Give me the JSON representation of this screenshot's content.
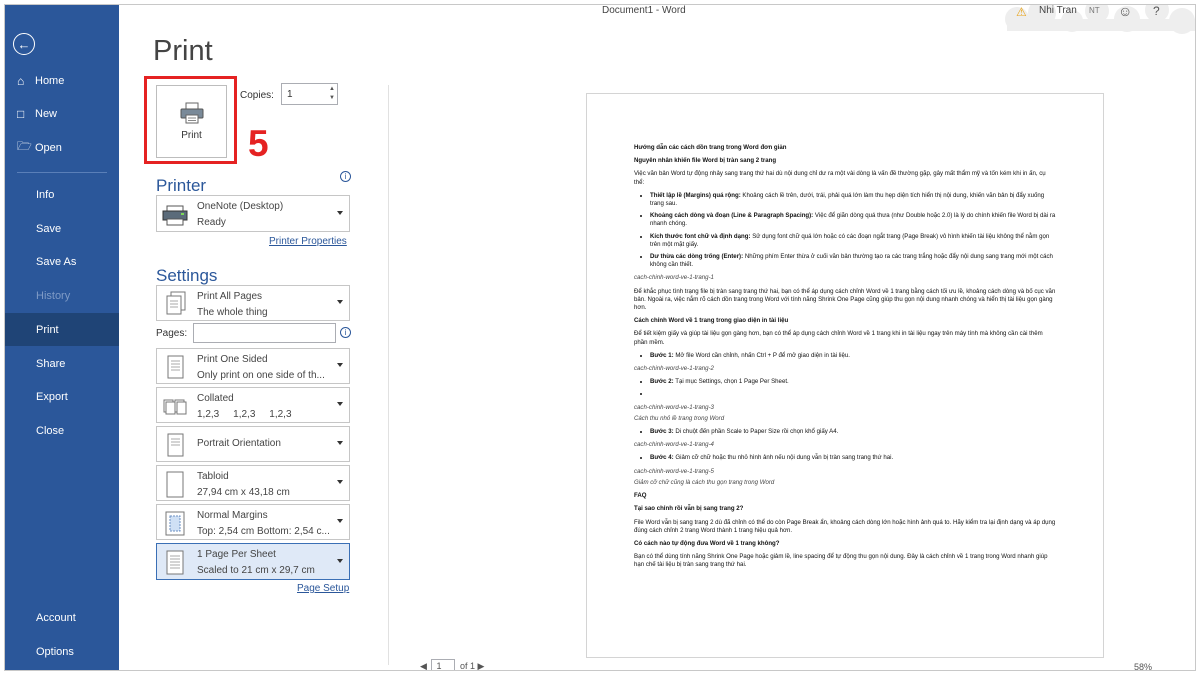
{
  "window": {
    "title": "Document1  -  Word",
    "user_name": "Nhi Tran",
    "user_initials": "NT"
  },
  "sidebar": {
    "items": [
      {
        "label": "Home",
        "icon": "home-icon"
      },
      {
        "label": "New",
        "icon": "new-document-icon"
      },
      {
        "label": "Open",
        "icon": "folder-icon"
      },
      {
        "label": "Info"
      },
      {
        "label": "Save"
      },
      {
        "label": "Save As"
      },
      {
        "label": "History"
      },
      {
        "label": "Print"
      },
      {
        "label": "Share"
      },
      {
        "label": "Export"
      },
      {
        "label": "Close"
      },
      {
        "label": "Account"
      },
      {
        "label": "Options"
      }
    ],
    "active": "Print",
    "disabled": "History"
  },
  "print_panel": {
    "title": "Print",
    "print_button_label": "Print",
    "step_number": "5",
    "copies_label": "Copies:",
    "copies_value": "1",
    "printer_heading": "Printer",
    "printer": {
      "name": "OneNote (Desktop)",
      "status": "Ready"
    },
    "printer_properties_link": "Printer Properties",
    "settings_heading": "Settings",
    "settings": [
      {
        "l1": "Print All Pages",
        "l2": "The whole thing",
        "icon": "pages-icon"
      },
      {
        "l1": "Print One Sided",
        "l2": "Only print on one side of th...",
        "icon": "one-sided-icon"
      },
      {
        "l1": "Collated",
        "l2": "1,2,3     1,2,3     1,2,3",
        "icon": "collated-icon"
      },
      {
        "l1": "Portrait Orientation",
        "l2": "",
        "icon": "portrait-icon"
      },
      {
        "l1": "Tabloid",
        "l2": "27,94 cm x 43,18 cm",
        "icon": "paper-size-icon"
      },
      {
        "l1": "Normal Margins",
        "l2": "Top: 2,54 cm Bottom: 2,54 c...",
        "icon": "margins-icon"
      },
      {
        "l1": "1 Page Per Sheet",
        "l2": "Scaled to 21 cm x 29,7 cm",
        "icon": "pages-per-sheet-icon"
      }
    ],
    "pages_label": "Pages:",
    "pages_value": "",
    "page_setup_link": "Page Setup"
  },
  "preview": {
    "current_page": "1",
    "of_pages": "of 1",
    "zoom": "58%",
    "content": {
      "title": "Hướng dẫn các cách dồn trang trong Word đơn giản",
      "h1": "Nguyên nhân khiến file Word bị tràn sang 2 trang",
      "p1": "Việc văn bản Word tự động nhảy sang trang thứ hai dù nội dung chỉ dư ra một vài dòng là vấn đề thường gặp, gây mất thẩm mỹ và tốn kém khi in ấn, cụ thể:",
      "bullets1": [
        {
          "b": "Thiết lập lề (Margins) quá rộng:",
          "t": " Khoảng cách lề trên, dưới, trái, phải quá lớn làm thu hẹp diện tích hiển thị nội dung, khiến văn bản bị đẩy xuống trang sau."
        },
        {
          "b": "Khoảng cách dòng và đoạn (Line & Paragraph Spacing):",
          "t": " Việc để giãn dòng quá thưa (như Double hoặc 2.0) là lý do chính khiến file Word bị dài ra nhanh chóng."
        },
        {
          "b": "Kích thước font chữ và định dạng:",
          "t": " Sử dụng font chữ quá lớn hoặc có các đoạn ngắt trang (Page Break) vô hình khiến tài liệu không thể nằm gọn trên một mặt giấy."
        },
        {
          "b": "Dư thừa các dòng trống (Enter):",
          "t": " Những phím Enter thừa ở cuối văn bản thường tạo ra các trang trắng hoặc đẩy nội dung sang trang mới một cách không cần thiết."
        }
      ],
      "cap1": "cach-chinh-word-ve-1-trang-1",
      "p2": "Để khắc phục tình trạng file bị tràn sang trang thứ hai, bạn có thể áp dụng cách chỉnh Word về 1 trang bằng cách tối ưu lề, khoảng cách dòng và bố cục văn bản. Ngoài ra, việc nắm rõ cách dồn trang trong Word với tính năng Shrink One Page cũng giúp thu gọn nội dung nhanh chóng và hiển thị tài liệu gọn gàng hơn.",
      "h2": "Cách chỉnh Word về 1 trang trong giao diện in tài liệu",
      "p3": "Để tiết kiệm giấy và giúp tài liệu gọn gàng hơn, bạn có thể áp dụng cách chỉnh Word về 1 trang khi in tài liệu ngay trên máy tính mà không cần cài thêm phần mềm.",
      "step1_b": "Bước 1:",
      "step1_t": " Mở file Word cần chỉnh, nhấn Ctrl + P để mở giao diện in tài liệu.",
      "cap2": "cach-chinh-word-ve-1-trang-2",
      "step2_b": "Bước 2:",
      "step2_t": " Tại mục Settings, chọn 1 Page Per Sheet.",
      "cap3": "cach-chinh-word-ve-1-trang-3",
      "cap3b": "Cách thu nhỏ lề trang trong Word",
      "step3_b": "Bước 3:",
      "step3_t": " Di chuột đến phần Scale to Paper Size rồi chọn khổ giấy A4.",
      "cap4": "cach-chinh-word-ve-1-trang-4",
      "step4_b": "Bước 4:",
      "step4_t": " Giảm cỡ chữ hoặc thu nhỏ hình ảnh nếu nội dung vẫn bị tràn sang trang thứ hai.",
      "cap5": "cach-chinh-word-ve-1-trang-5",
      "cap5b": "Giảm cỡ chữ cũng là cách thu gọn trang trong Word",
      "faq": "FAQ",
      "q1": "Tại sao chỉnh rồi vẫn bị sang trang 2?",
      "a1": "File Word vẫn bị sang trang 2 dù đã chỉnh có thể do còn Page Break ẩn, khoảng cách dòng lớn hoặc hình ảnh quá to. Hãy kiểm tra lại định dạng và áp dụng đúng cách chỉnh 2 trang Word thành 1 trang hiệu quả hơn.",
      "q2": "Có cách nào tự động đưa Word về 1 trang không?",
      "a2": "Bạn có thể dùng tính năng Shrink One Page hoặc giảm lề, line spacing để tự động thu gọn nội dung. Đây là cách chỉnh về 1 trang trong Word nhanh giúp hạn chế tài liệu bị tràn sang trang thứ hai."
    }
  },
  "colors": {
    "sidebar": "#2b579a",
    "sidebar_active": "#1f4476",
    "accent": "#2b579a",
    "highlight": "#e52222"
  }
}
